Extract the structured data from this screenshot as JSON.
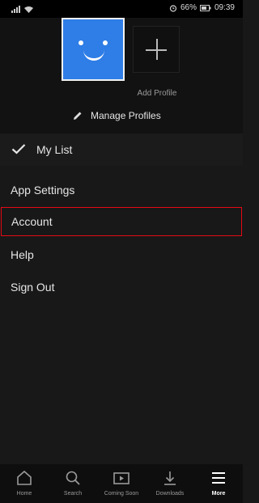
{
  "status_bar": {
    "battery": "66%",
    "time": "09:39"
  },
  "profiles": {
    "add_label": "Add Profile",
    "manage_label": "Manage Profiles"
  },
  "my_list": {
    "label": "My List"
  },
  "menu": {
    "items": [
      {
        "label": "App Settings"
      },
      {
        "label": "Account"
      },
      {
        "label": "Help"
      },
      {
        "label": "Sign Out"
      }
    ]
  },
  "bottom_nav": {
    "items": [
      {
        "label": "Home",
        "icon": "home-icon"
      },
      {
        "label": "Search",
        "icon": "search-icon"
      },
      {
        "label": "Coming Soon",
        "icon": "play-icon"
      },
      {
        "label": "Downloads",
        "icon": "download-icon"
      },
      {
        "label": "More",
        "icon": "menu-icon"
      }
    ]
  },
  "colors": {
    "accent": "#e50914",
    "avatar": "#2f7de6"
  }
}
